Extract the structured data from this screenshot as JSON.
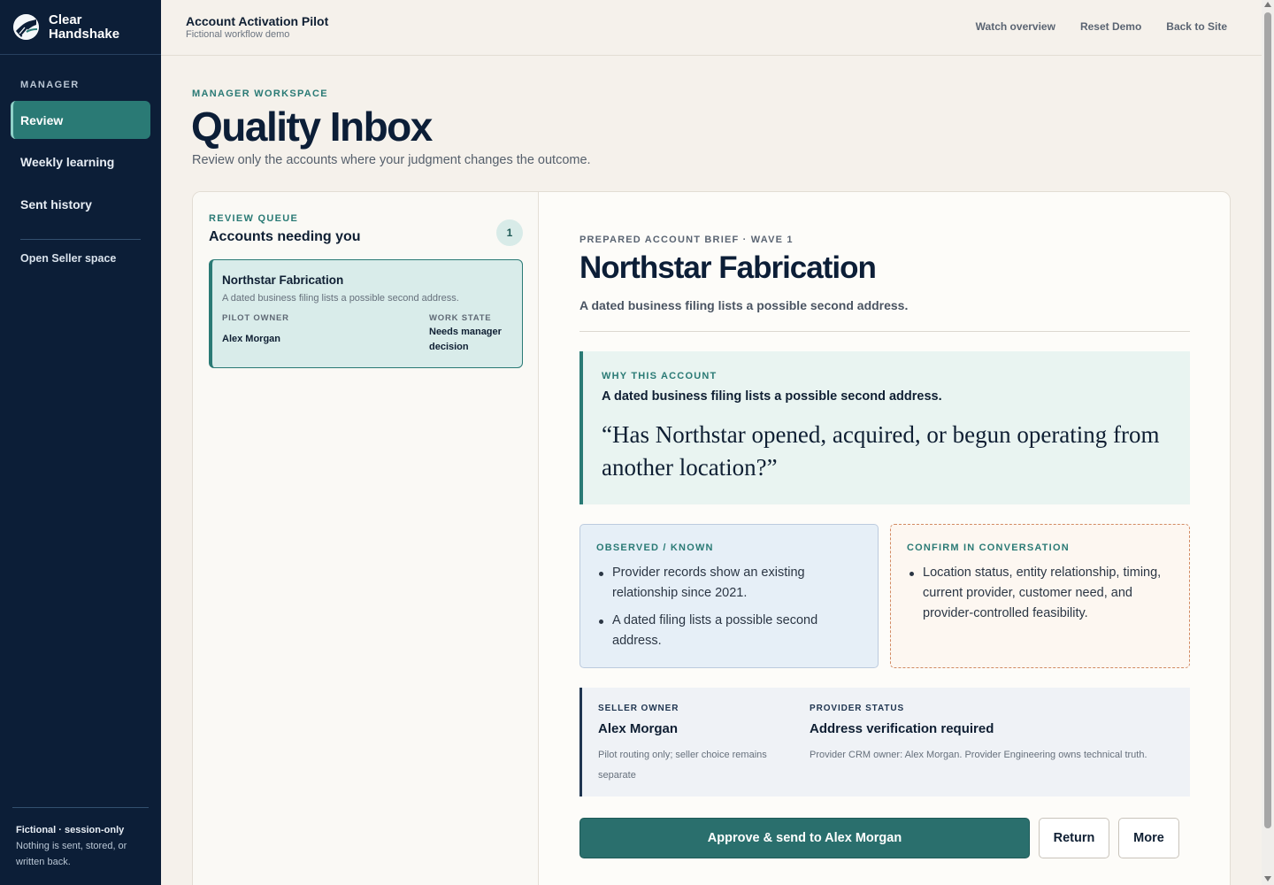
{
  "brand": {
    "name": "Clear\nHandshake"
  },
  "header": {
    "title": "Account Activation Pilot",
    "subtitle": "Fictional workflow demo",
    "links": [
      "Watch overview",
      "Reset Demo",
      "Back to Site"
    ]
  },
  "sidebar": {
    "section_label": "MANAGER",
    "items": [
      {
        "label": "Review",
        "active": true
      },
      {
        "label": "Weekly learning",
        "active": false
      },
      {
        "label": "Sent history",
        "active": false
      }
    ],
    "secondary_link": "Open Seller space",
    "footer_title": "Fictional · session-only",
    "footer_text": "Nothing is sent, stored, or written back."
  },
  "page": {
    "eyebrow": "MANAGER WORKSPACE",
    "title": "Quality Inbox",
    "subtitle": "Review only the accounts where your judgment changes the outcome."
  },
  "queue": {
    "eyebrow": "REVIEW QUEUE",
    "title": "Accounts needing you",
    "count": "1",
    "items": [
      {
        "name": "Northstar Fabrication",
        "description": "A dated business filing lists a possible second address.",
        "owner_label": "PILOT OWNER",
        "owner": "Alex Morgan",
        "state_label": "WORK STATE",
        "state": "Needs manager decision"
      }
    ]
  },
  "brief": {
    "eyebrow": "PREPARED ACCOUNT BRIEF · WAVE 1",
    "title": "Northstar Fabrication",
    "subtitle": "A dated business filing lists a possible second address.",
    "why": {
      "label": "WHY THIS ACCOUNT",
      "headline": "A dated business filing lists a possible second address.",
      "quote": "“Has Northstar opened, acquired, or begun operating from another location?”"
    },
    "observed": {
      "label": "OBSERVED / KNOWN",
      "items": [
        "Provider records show an existing relationship since 2021.",
        "A dated filing lists a possible second address."
      ]
    },
    "confirm": {
      "label": "CONFIRM IN CONVERSATION",
      "items": [
        "Location status, entity relationship, timing, current provider, customer need, and provider-controlled feasibility."
      ]
    },
    "seller_owner": {
      "label": "SELLER OWNER",
      "value": "Alex Morgan",
      "note": "Pilot routing only; seller choice remains separate"
    },
    "provider_status": {
      "label": "PROVIDER STATUS",
      "value": "Address verification required",
      "note": "Provider CRM owner: Alex Morgan. Provider Engineering owns technical truth."
    },
    "actions": {
      "approve": "Approve & send to Alex Morgan",
      "return": "Return",
      "more": "More"
    }
  },
  "colors": {
    "sidebar": "#0c1e37",
    "accent": "#2a7a75",
    "primary_button": "#2a6f6d",
    "background": "#f5f1eb"
  }
}
